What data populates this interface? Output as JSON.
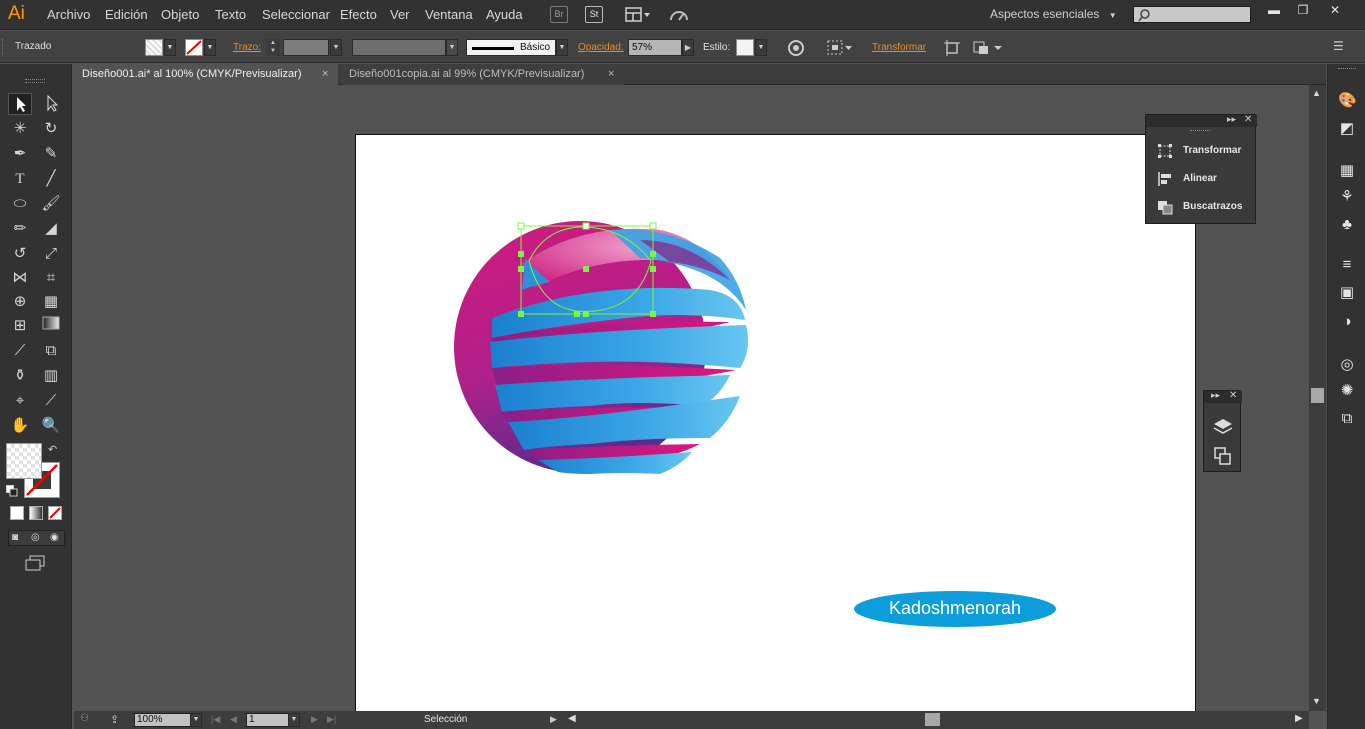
{
  "app": {
    "logo": "Ai"
  },
  "menu": {
    "items": [
      "Archivo",
      "Edición",
      "Objeto",
      "Texto",
      "Seleccionar",
      "Efecto",
      "Ver",
      "Ventana",
      "Ayuda"
    ]
  },
  "menubar_icons": {
    "bridge": "Br",
    "stock": "St"
  },
  "workspace": {
    "label": "Aspectos esenciales"
  },
  "controlbar": {
    "selection_label": "Trazado",
    "stroke_label": "Trazo:",
    "brush_label": "Básico",
    "opacity_label": "Opacidad:",
    "opacity_value": "57%",
    "style_label": "Estilo:",
    "transform_label": "Transformar"
  },
  "tabs": [
    {
      "label": "Diseño001.ai* al 100% (CMYK/Previsualizar)",
      "close": "×"
    },
    {
      "label": "Diseño001copia.ai al 99% (CMYK/Previsualizar)",
      "close": "×"
    }
  ],
  "artboard": {
    "badge_text": "Kadoshmenorah",
    "badge_color": "#0d9ddb",
    "selection_color": "#7bf542",
    "sphere_colors": {
      "magenta": "#c81e82",
      "purple": "#6b2a8e",
      "blue": "#1f8fd6",
      "light_blue": "#5ec2ef",
      "pink": "#e683b9"
    }
  },
  "float_panel": {
    "items": [
      {
        "label": "Transformar",
        "icon": "transform-icon"
      },
      {
        "label": "Alinear",
        "icon": "align-icon"
      },
      {
        "label": "Buscatrazos",
        "icon": "pathfinder-icon"
      }
    ]
  },
  "statusbar": {
    "zoom": "100%",
    "page": "1",
    "tool_status": "Selección"
  }
}
